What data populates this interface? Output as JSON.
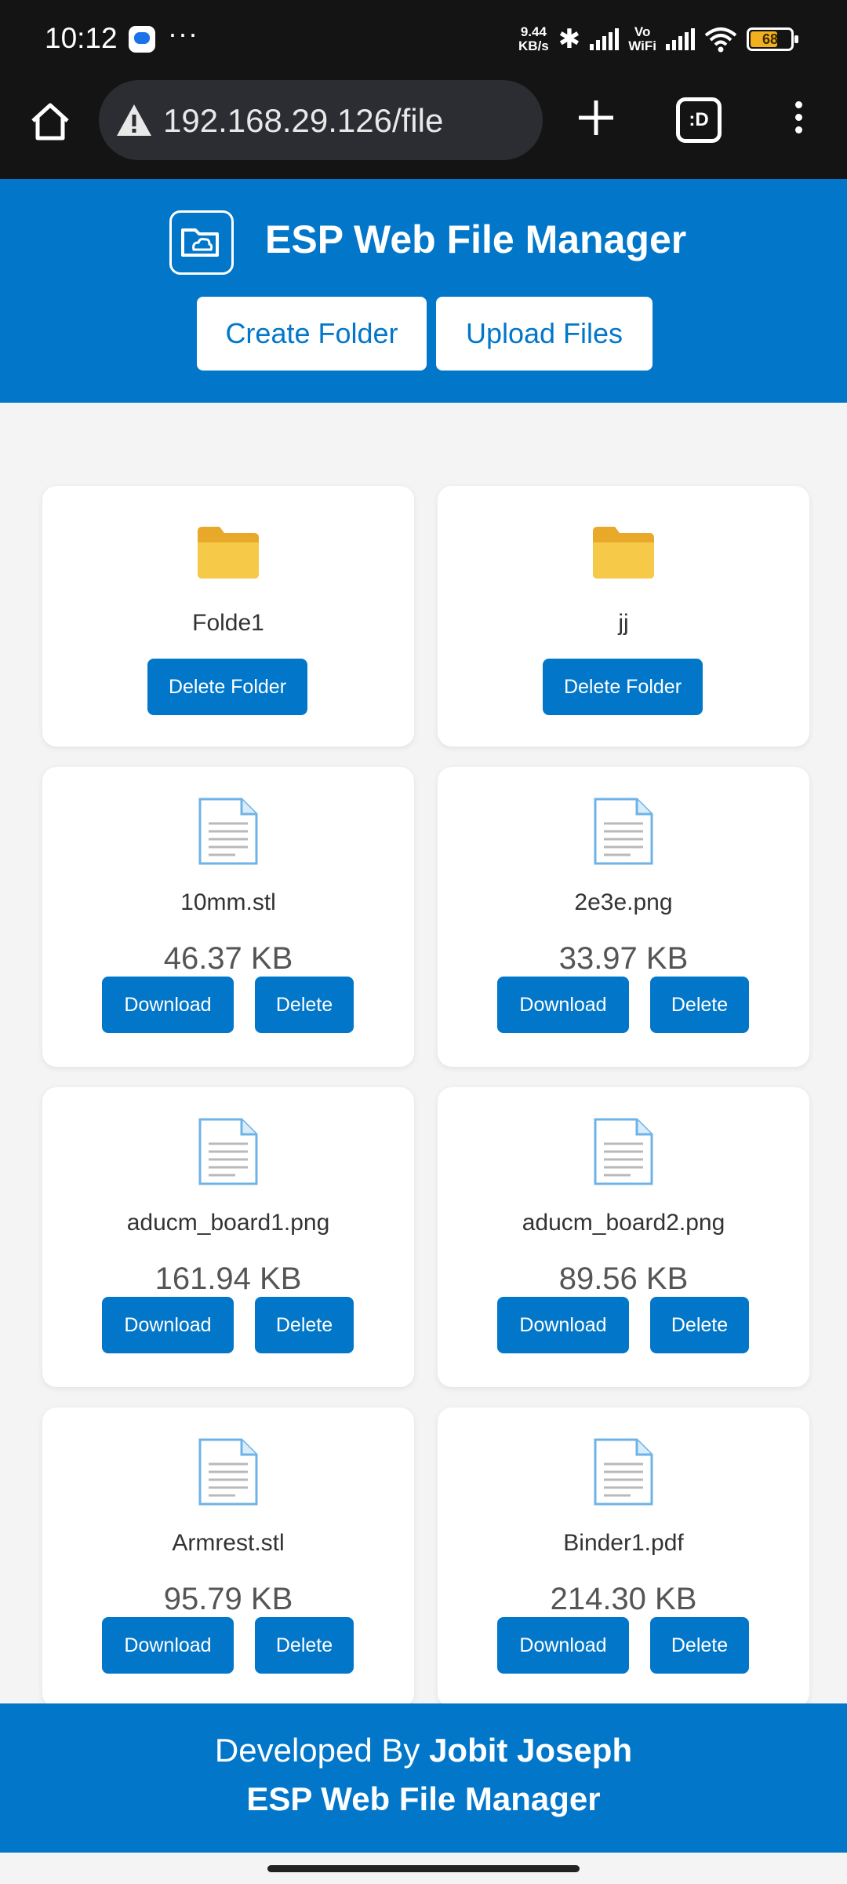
{
  "status_bar": {
    "time": "10:12",
    "speed_value": "9.44",
    "speed_unit": "KB/s",
    "vo": "Vo",
    "wifi_label": "WiFi",
    "battery": "68"
  },
  "browser": {
    "url": "192.168.29.126/file",
    "tabs_label": ":D"
  },
  "header": {
    "title": "ESP Web File Manager",
    "create_folder": "Create Folder",
    "upload_files": "Upload Files"
  },
  "folders": [
    {
      "name": "Folde1",
      "action": "Delete Folder"
    },
    {
      "name": "jj",
      "action": "Delete Folder"
    }
  ],
  "files": [
    {
      "name": "10mm.stl",
      "size": "46.37 KB",
      "download": "Download",
      "delete": "Delete"
    },
    {
      "name": "2e3e.png",
      "size": "33.97 KB",
      "download": "Download",
      "delete": "Delete"
    },
    {
      "name": "aducm_board1.png",
      "size": "161.94 KB",
      "download": "Download",
      "delete": "Delete"
    },
    {
      "name": "aducm_board2.png",
      "size": "89.56 KB",
      "download": "Download",
      "delete": "Delete"
    },
    {
      "name": "Armrest.stl",
      "size": "95.79 KB",
      "download": "Download",
      "delete": "Delete"
    },
    {
      "name": "Binder1.pdf",
      "size": "214.30 KB",
      "download": "Download",
      "delete": "Delete"
    }
  ],
  "footer": {
    "developed_by": "Developed By",
    "author": "Jobit Joseph",
    "app_name": "ESP Web File Manager"
  },
  "colors": {
    "brand_blue": "#0277c9",
    "page_bg": "#f4f4f4",
    "folder_yellow": "#f7c948"
  }
}
